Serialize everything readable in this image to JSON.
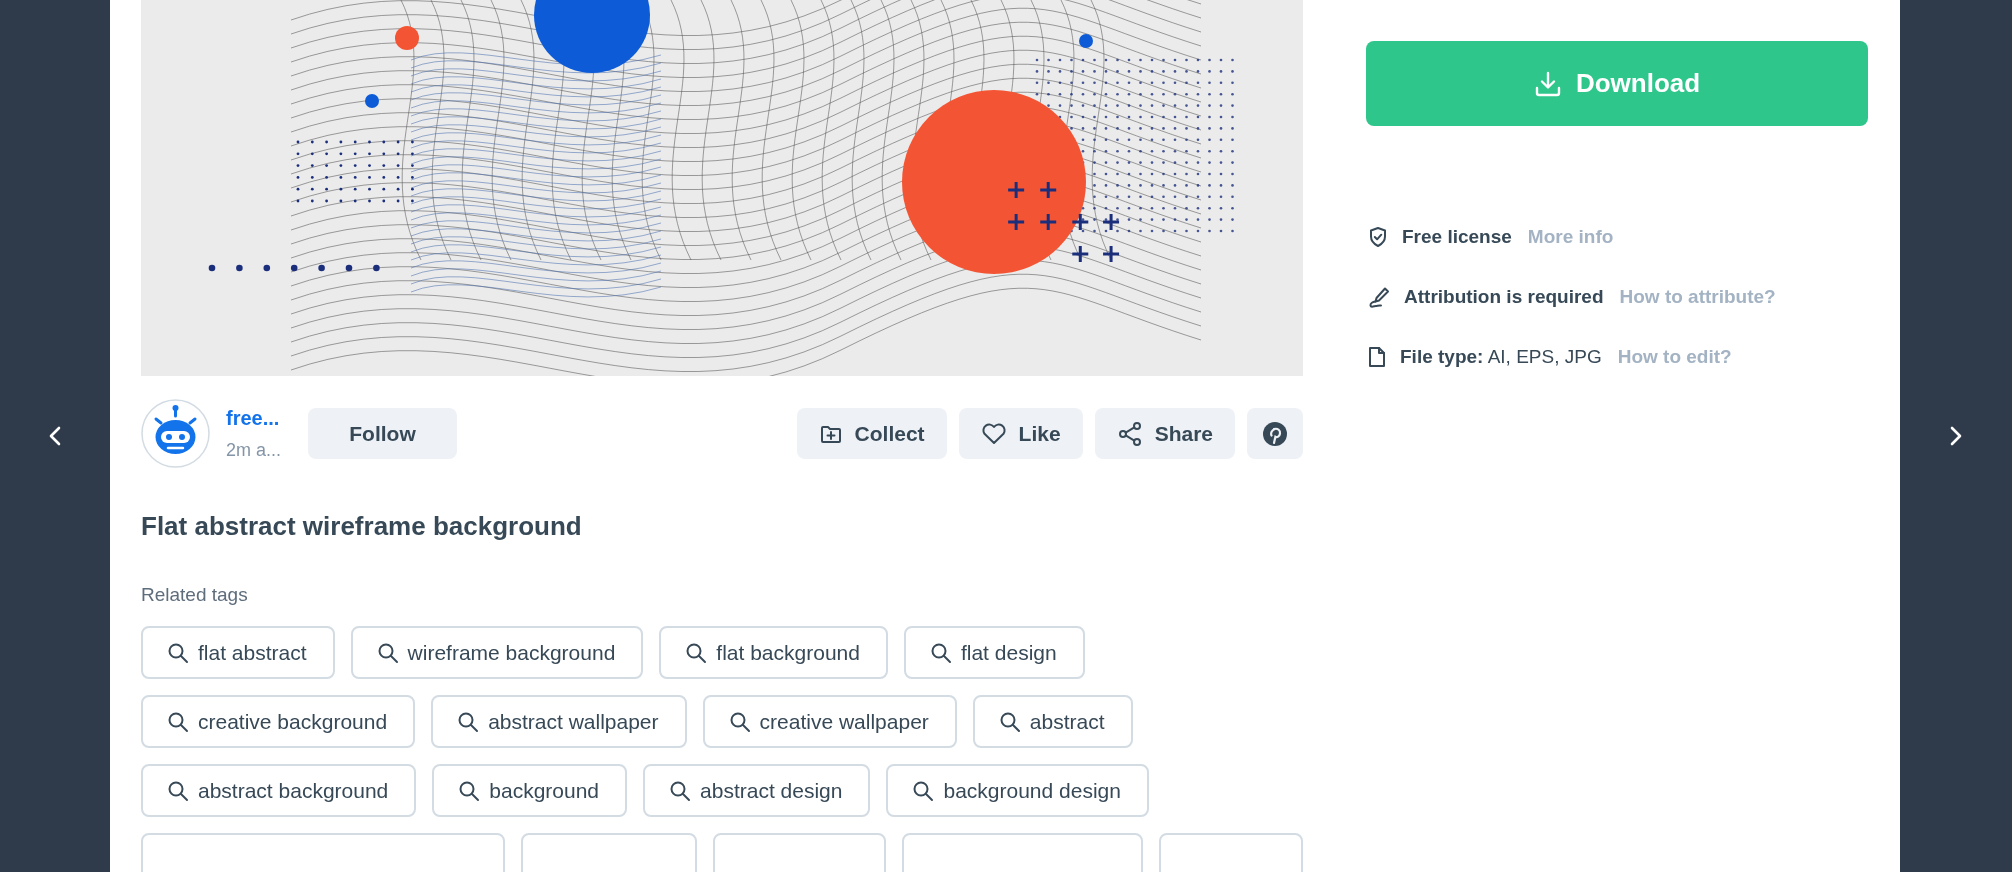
{
  "author": {
    "name": "free...",
    "time": "2m a..."
  },
  "follow_button": "Follow",
  "actions": [
    {
      "kind": "collect",
      "label": "Collect"
    },
    {
      "kind": "like",
      "label": "Like"
    },
    {
      "kind": "share",
      "label": "Share"
    },
    {
      "kind": "pinterest"
    }
  ],
  "title": "Flat abstract wireframe background",
  "related_tags": {
    "heading": "Related tags",
    "rows": [
      [
        "flat abstract",
        "wireframe background",
        "flat background",
        "flat design"
      ],
      [
        "creative background",
        "abstract wallpaper",
        "creative wallpaper",
        "abstract"
      ],
      [
        "abstract background",
        "background",
        "abstract design",
        "background design"
      ]
    ]
  },
  "download_button": "Download",
  "info": [
    {
      "kind": "license",
      "label": "Free license",
      "link": "More info"
    },
    {
      "kind": "attribution",
      "label": "Attribution is required",
      "link": "How to attribute?"
    },
    {
      "kind": "file_type",
      "label": "**File type:** AI, EPS, JPG",
      "link": "How to edit?"
    }
  ]
}
